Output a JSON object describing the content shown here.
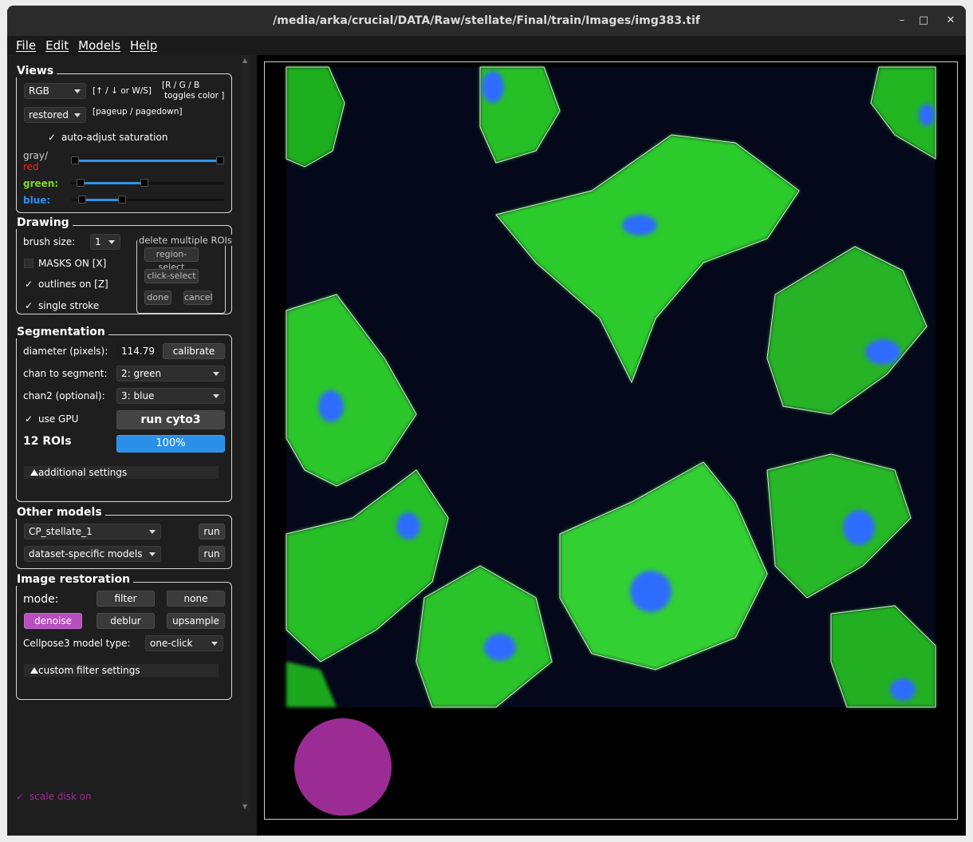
{
  "window": {
    "title": "/media/arka/crucial/DATA/Raw/stellate/Final/train/Images/img383.tif"
  },
  "menu": [
    "File",
    "Edit",
    "Models",
    "Help"
  ],
  "views": {
    "title": "Views",
    "color_mode": "RGB",
    "color_hint": "[↑ / ↓ or W/S]",
    "rgb_hint": "[R / G / B",
    "rgb_hint2": "toggles color ]",
    "image_view": "restored",
    "page_hint": "[pageup / pagedown]",
    "auto_adjust": "auto-adjust saturation",
    "auto_adjust_checked": true,
    "gray_label": "gray/",
    "red_label": "red",
    "green_label": "green:",
    "blue_label": "blue:",
    "colors": {
      "gray": "#cfcfcf",
      "red": "#ff1f1f",
      "green": "#7ddc1f",
      "blue": "#2f8ff0",
      "accent": "#2f93e8"
    }
  },
  "drawing": {
    "title": "Drawing",
    "brush_label": "brush size:",
    "brush_value": "1",
    "masks_label": "MASKS ON [X]",
    "masks_checked": false,
    "outlines_label": "outlines on [Z]",
    "outlines_checked": true,
    "stroke_label": "single stroke",
    "stroke_checked": true,
    "delete_title": "delete multiple ROIs",
    "region_select": "region-select",
    "click_select": "click-select",
    "done": "done",
    "cancel": "cancel"
  },
  "segmentation": {
    "title": "Segmentation",
    "diameter_label": "diameter (pixels):",
    "diameter_value": "114.79",
    "calibrate": "calibrate",
    "chan_label": "chan to segment:",
    "chan_value": "2: green",
    "chan2_label": "chan2 (optional):",
    "chan2_value": "3: blue",
    "gpu_label": "use GPU",
    "gpu_checked": true,
    "run_button": "run cyto3",
    "roi_count": "12 ROIs",
    "progress": "100%",
    "additional": "additional settings"
  },
  "other_models": {
    "title": "Other models",
    "model1": "CP_stellate_1",
    "model2": "dataset-specific models",
    "run": "run"
  },
  "restoration": {
    "title": "Image restoration",
    "mode_label": "mode:",
    "filter": "filter",
    "none": "none",
    "denoise": "denoise",
    "deblur": "deblur",
    "upsample": "upsample",
    "model_type_label": "Cellpose3 model type:",
    "model_type_value": "one-click",
    "custom": "custom filter settings",
    "active_color": "#b94fbf"
  },
  "scale_disk": {
    "label": "scale disk on",
    "checked": true,
    "color": "#9b2c93"
  }
}
